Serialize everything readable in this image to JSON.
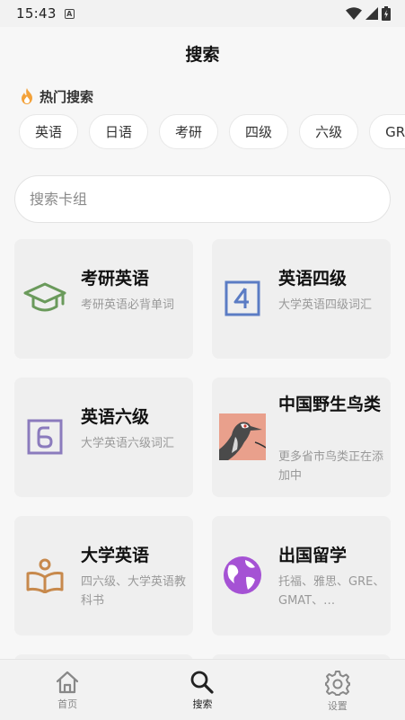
{
  "status_bar": {
    "time": "15:43",
    "a_badge": "A"
  },
  "header": {
    "title": "搜索"
  },
  "hot_search": {
    "title": "热门搜索",
    "icon": "flame-icon",
    "chips": [
      "英语",
      "日语",
      "考研",
      "四级",
      "六级",
      "GRE"
    ]
  },
  "search": {
    "placeholder": "搜索卡组",
    "value": ""
  },
  "cards": [
    {
      "title": "考研英语",
      "desc": "考研英语必背单词",
      "icon": "graduation-cap-icon",
      "color": "#6a9a5b"
    },
    {
      "title": "英语四级",
      "desc": "大学英语四级词汇",
      "icon": "number-4-icon",
      "color": "#5b7cc4"
    },
    {
      "title": "英语六级",
      "desc": "大学英语六级词汇",
      "icon": "number-6-icon",
      "color": "#8b7bbd"
    },
    {
      "title": "中国野生鸟类",
      "desc": "更多省市鸟类正在添加中",
      "icon": "bird-image",
      "color": "#e9a08c"
    },
    {
      "title": "大学英语",
      "desc": "四六级、大学英语教科书",
      "icon": "open-book-icon",
      "color": "#c7894c"
    },
    {
      "title": "出国留学",
      "desc": "托福、雅思、GRE、GMAT、…",
      "icon": "globe-icon",
      "color": "#a552d4"
    }
  ],
  "tab_bar": {
    "items": [
      {
        "label": "首页",
        "icon": "home-icon"
      },
      {
        "label": "搜索",
        "icon": "search-icon",
        "active": true
      },
      {
        "label": "设置",
        "icon": "gear-icon"
      }
    ]
  }
}
